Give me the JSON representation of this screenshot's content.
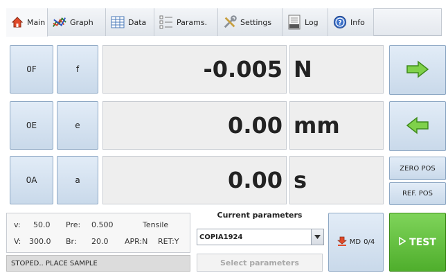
{
  "tabs": [
    {
      "label": "Main",
      "icon": "home-icon",
      "active": true
    },
    {
      "label": "Graph",
      "icon": "graph-icon",
      "active": false
    },
    {
      "label": "Data",
      "icon": "table-icon",
      "active": false
    },
    {
      "label": "Params.",
      "icon": "params-icon",
      "active": false
    },
    {
      "label": "Settings",
      "icon": "tools-icon",
      "active": false
    },
    {
      "label": "Log",
      "icon": "log-icon",
      "active": false
    },
    {
      "label": "Info",
      "icon": "info-icon",
      "active": false
    }
  ],
  "channels": [
    {
      "zero_label": "0F",
      "key_label": "f",
      "value": "-0.005",
      "unit": "N"
    },
    {
      "zero_label": "0E",
      "key_label": "e",
      "value": "0.00",
      "unit": "mm"
    },
    {
      "zero_label": "0A",
      "key_label": "a",
      "value": "0.00",
      "unit": "s"
    }
  ],
  "motion": {
    "forward_icon": "arrow-right-icon",
    "back_icon": "arrow-left-icon",
    "zero_pos_label": "ZERO POS",
    "ref_pos_label": "REF. POS"
  },
  "info": {
    "v_label": "v:",
    "v_value": "50.0",
    "pre_label": "Pre:",
    "pre_value": "0.500",
    "mode": "Tensile",
    "V_label": "V:",
    "V_value": "300.0",
    "br_label": "Br:",
    "br_value": "20.0",
    "apr": "APR:N",
    "ret": "RET:Y"
  },
  "status": "STOPED.. PLACE SAMPLE",
  "current_parameters": {
    "title": "Current parameters",
    "selected": "COPIA1924",
    "select_label": "Select parameters"
  },
  "md_button": {
    "label": "MD",
    "count": "0/4",
    "icon": "download-icon"
  },
  "test_button": {
    "label": "TEST",
    "icon": "play-icon"
  },
  "colors": {
    "button_fill": "#c9d9ea",
    "button_border": "#8ea8c4",
    "arrow_green": "#7fd14a",
    "test_green": "#5fbf3a"
  }
}
